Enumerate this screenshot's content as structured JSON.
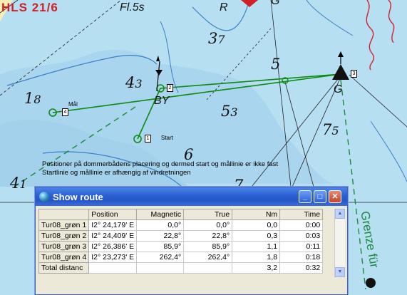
{
  "chart_labels": {
    "header_left": "HLS 21/6",
    "light_char": "Fl.5s",
    "buoy_r": "R",
    "buoy_g_top": "G",
    "buoy_g": "G",
    "buoy_by": "BY",
    "grenze": "Grenze für",
    "depths": [
      {
        "main": "3",
        "sub": "7"
      },
      {
        "main": "5",
        "sub": ""
      },
      {
        "main": "4",
        "sub": "3"
      },
      {
        "main": "1",
        "sub": "8"
      },
      {
        "main": "5",
        "sub": "3"
      },
      {
        "main": "7",
        "sub": "5"
      },
      {
        "main": "6",
        "sub": ""
      },
      {
        "main": "4",
        "sub": "1"
      },
      {
        "main": "7",
        "sub": ""
      }
    ]
  },
  "waypoints": {
    "start_label": "Start",
    "finish_label": "Mål",
    "ids": [
      "1",
      "2",
      "3",
      "4"
    ]
  },
  "note": {
    "line1": "Positioner på dommerbådens placering og dermed start og mållinie er ikke fast",
    "line2": "Startlinie og mållinie er  afhængig af vindretningen"
  },
  "window": {
    "title": "Show route",
    "min_glyph": "_",
    "max_glyph": "□",
    "close_glyph": "✕",
    "columns": [
      "",
      "Position",
      "Magnetic",
      "True",
      "Nm",
      "Time"
    ],
    "rows": [
      [
        "Tur08_grøn 1",
        "I2° 24,179' E",
        "0,0°",
        "0,0°",
        "0,0",
        "0:00"
      ],
      [
        "Tur08_grøn 2",
        "I2° 24,409' E",
        "22,8°",
        "22,8°",
        "0,3",
        "0:03"
      ],
      [
        "Tur08_grøn 3",
        "I2° 26,386' E",
        "85,9°",
        "85,9°",
        "1,1",
        "0:11"
      ],
      [
        "Tur08_grøn 4",
        "I2° 23,273' E",
        "262,4°",
        "262,4°",
        "1,8",
        "0:18"
      ],
      [
        "Total distanc",
        "",
        "",
        "",
        "3,2",
        "0:32"
      ]
    ]
  },
  "colors": {
    "water": "#b7dff2",
    "shallow": "#9fcfe9",
    "route": "#0c8a12",
    "title_blue": "#2a61d6",
    "accent_red": "#d2202a",
    "grenze_green": "#1a8a3a"
  }
}
